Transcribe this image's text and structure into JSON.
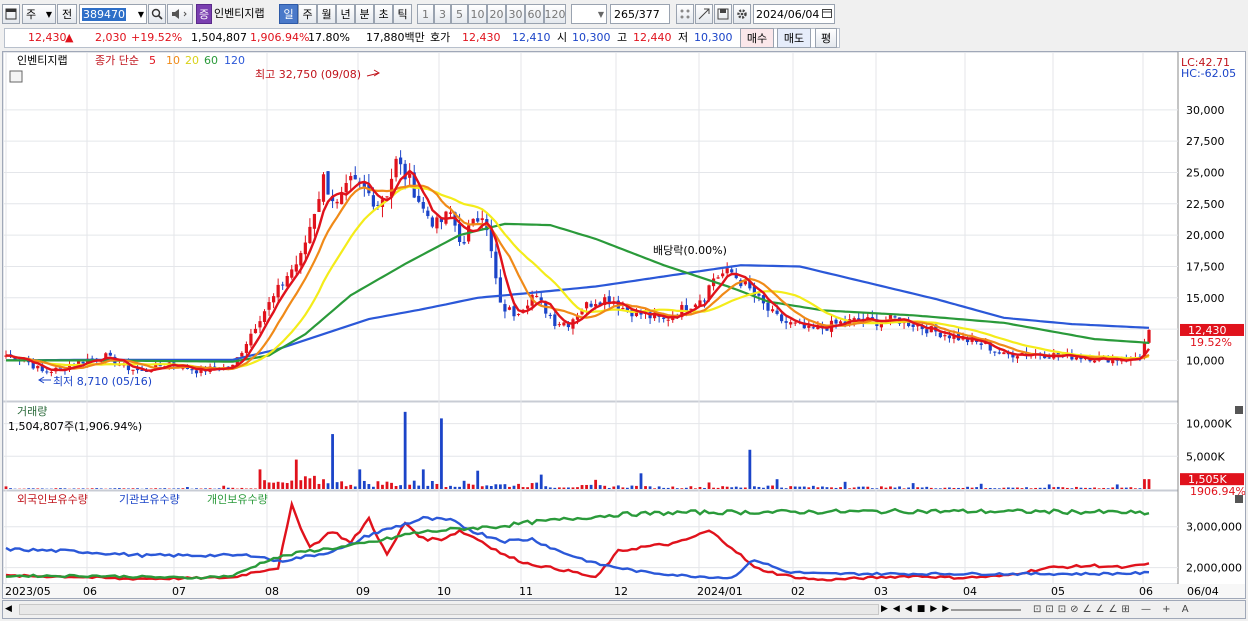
{
  "toolbar": {
    "market_label": "주",
    "prev_label": "전",
    "code": "389470",
    "company_name": "인벤티지랩",
    "company_badge": "증",
    "periods": [
      "일",
      "주",
      "월",
      "년",
      "분",
      "초",
      "틱"
    ],
    "active_period": "일",
    "minute_options": [
      "1",
      "3",
      "5",
      "10",
      "20",
      "30",
      "60",
      "120"
    ],
    "count_current": "265",
    "count_total": "/377",
    "date": "2024/06/04"
  },
  "quote": {
    "price": "12,430",
    "arrow": "▲",
    "change": "2,030",
    "change_rate": "+19.52%",
    "volume": "1,504,807",
    "volume_rate": "1,906.94%",
    "turnover": "17.80%",
    "amount": "17,880백만",
    "bid_label": "호가",
    "bid1": "12,430",
    "bid2": "12,410",
    "open_label": "시",
    "open": "10,300",
    "high_label": "고",
    "high": "12,440",
    "low_label": "저",
    "low": "10,300",
    "buy_label": "매수",
    "sell_label": "매도",
    "eval_label": "평"
  },
  "price_panel": {
    "name": "인벤티지랩",
    "ma_label": "종가 단순",
    "ma_periods": [
      "5",
      "10",
      "20",
      "60",
      "120"
    ],
    "high_annotation": "최고 32,750 (09/08)",
    "low_annotation": "최저 8,710 (05/16)",
    "dividend_annotation": "배당락(0.00%)",
    "lc": "LC:42.71",
    "hc": "HC:-62.05",
    "last_price_tag": "12,430",
    "last_rate_tag": "19.52%",
    "y_ticks": [
      "30,000",
      "27,500",
      "25,000",
      "22,500",
      "20,000",
      "17,500",
      "15,000",
      "12,500",
      "10,000"
    ]
  },
  "volume_panel": {
    "title": "거래량",
    "summary": "1,504,807주(1,906.94%)",
    "y_ticks": [
      "10,000K",
      "5,000K"
    ],
    "last_tag": "1,505K",
    "last_rate": "1906.94%"
  },
  "holding_panel": {
    "series_labels": [
      "외국인보유수량",
      "기관보유수량",
      "개인보유수량"
    ],
    "y_ticks": [
      "3,000,000",
      "2,000,000"
    ]
  },
  "x_axis": [
    "2023/05",
    "06",
    "07",
    "08",
    "09",
    "10",
    "11",
    "12",
    "2024/01",
    "02",
    "03",
    "04",
    "05",
    "06",
    "06/04"
  ],
  "colors": {
    "ma5": "#e0121c",
    "ma10": "#f08a18",
    "ma20": "#f4ec1a",
    "ma60": "#2a9a3a",
    "ma120": "#2b58d8",
    "up": "#e0121c",
    "down": "#1b44c8"
  },
  "chart_data": {
    "type": "candlestick",
    "price_ylim": [
      7000,
      33500
    ],
    "volume_ylim": [
      0,
      13000
    ],
    "holding_ylim": [
      1650000,
      3800000
    ],
    "x_labels": [
      "2023/05",
      "06",
      "07",
      "08",
      "09",
      "10",
      "11",
      "12",
      "2024/01",
      "02",
      "03",
      "04",
      "05",
      "06"
    ],
    "close_path": [
      [
        0,
        10400
      ],
      [
        4,
        10100
      ],
      [
        8,
        9100
      ],
      [
        12,
        9300
      ],
      [
        18,
        10100
      ],
      [
        22,
        10300
      ],
      [
        26,
        9500
      ],
      [
        30,
        9100
      ],
      [
        36,
        9800
      ],
      [
        42,
        9200
      ],
      [
        48,
        9400
      ],
      [
        50,
        9500
      ],
      [
        53,
        11500
      ],
      [
        56,
        13500
      ],
      [
        59,
        15000
      ],
      [
        62,
        16800
      ],
      [
        65,
        18200
      ],
      [
        68,
        22000
      ],
      [
        70,
        24500
      ],
      [
        73,
        22300
      ],
      [
        76,
        24100
      ],
      [
        79,
        23600
      ],
      [
        82,
        22600
      ],
      [
        84,
        23500
      ],
      [
        86,
        25800
      ],
      [
        88,
        24800
      ],
      [
        90,
        23700
      ],
      [
        92,
        22000
      ],
      [
        95,
        20800
      ],
      [
        98,
        21700
      ],
      [
        101,
        19000
      ],
      [
        103,
        21600
      ],
      [
        105,
        21800
      ],
      [
        107,
        18500
      ],
      [
        109,
        14300
      ],
      [
        112,
        13800
      ],
      [
        114,
        14400
      ],
      [
        116,
        15200
      ],
      [
        118,
        14500
      ],
      [
        121,
        13100
      ],
      [
        124,
        13000
      ],
      [
        127,
        14200
      ],
      [
        130,
        14800
      ],
      [
        133,
        15000
      ],
      [
        136,
        14200
      ],
      [
        139,
        13800
      ],
      [
        142,
        13500
      ],
      [
        145,
        13200
      ],
      [
        148,
        13900
      ],
      [
        151,
        14500
      ],
      [
        154,
        15200
      ],
      [
        156,
        16600
      ],
      [
        158,
        16900
      ],
      [
        160,
        17000
      ],
      [
        162,
        16300
      ],
      [
        164,
        15600
      ],
      [
        166,
        14800
      ],
      [
        168,
        14000
      ],
      [
        170,
        13400
      ],
      [
        172,
        13000
      ],
      [
        174,
        12800
      ],
      [
        177,
        12400
      ],
      [
        180,
        12600
      ],
      [
        184,
        13000
      ],
      [
        188,
        13200
      ],
      [
        192,
        13100
      ],
      [
        196,
        13300
      ],
      [
        200,
        12900
      ],
      [
        204,
        12400
      ],
      [
        208,
        12000
      ],
      [
        212,
        11600
      ],
      [
        216,
        11200
      ],
      [
        220,
        10400
      ],
      [
        224,
        10600
      ],
      [
        228,
        10500
      ],
      [
        232,
        10400
      ],
      [
        236,
        10300
      ],
      [
        240,
        10200
      ],
      [
        244,
        10100
      ],
      [
        248,
        10100
      ],
      [
        250,
        10400
      ],
      [
        252,
        12430
      ]
    ],
    "ma120_path": [
      [
        0,
        10000
      ],
      [
        20,
        10050
      ],
      [
        50,
        10050
      ],
      [
        60,
        10900
      ],
      [
        70,
        12100
      ],
      [
        80,
        13300
      ],
      [
        92,
        14100
      ],
      [
        104,
        15000
      ],
      [
        116,
        15400
      ],
      [
        130,
        15900
      ],
      [
        145,
        16700
      ],
      [
        162,
        17600
      ],
      [
        175,
        17500
      ],
      [
        190,
        16200
      ],
      [
        205,
        14900
      ],
      [
        220,
        13400
      ],
      [
        235,
        12900
      ],
      [
        252,
        12600
      ]
    ],
    "ma60_path": [
      [
        0,
        10000
      ],
      [
        20,
        10000
      ],
      [
        50,
        9900
      ],
      [
        58,
        10400
      ],
      [
        66,
        12100
      ],
      [
        76,
        15200
      ],
      [
        88,
        17700
      ],
      [
        100,
        20000
      ],
      [
        110,
        20900
      ],
      [
        120,
        20800
      ],
      [
        130,
        19700
      ],
      [
        145,
        17600
      ],
      [
        160,
        15800
      ],
      [
        168,
        14700
      ],
      [
        180,
        14000
      ],
      [
        200,
        13600
      ],
      [
        220,
        13000
      ],
      [
        240,
        11700
      ],
      [
        252,
        11400
      ]
    ],
    "volume_by_month_peak_k": [
      {
        "x": "2023/05",
        "v": 400
      },
      {
        "x": "07/late",
        "v": 3000
      },
      {
        "x": "08",
        "v": 8400
      },
      {
        "x": "09",
        "v": 12000
      },
      {
        "x": "10",
        "v": 3000
      },
      {
        "x": "11",
        "v": 2500
      },
      {
        "x": "12",
        "v": 1300
      },
      {
        "x": "2024/01",
        "v": 6000
      },
      {
        "x": "02",
        "v": 1100
      },
      {
        "x": "03",
        "v": 800
      },
      {
        "x": "04",
        "v": 700
      },
      {
        "x": "05",
        "v": 700
      },
      {
        "x": "06/04",
        "v": 1505
      }
    ],
    "last_close": 12430,
    "last_volume_k": 1505,
    "holding_series": [
      {
        "name": "외국인보유수량",
        "color": "#e0121c",
        "path": [
          [
            0,
            1800000
          ],
          [
            15,
            1780000
          ],
          [
            25,
            1730000
          ],
          [
            40,
            1740000
          ],
          [
            50,
            1760000
          ],
          [
            55,
            1900000
          ],
          [
            60,
            2000000
          ],
          [
            63,
            3500000
          ],
          [
            67,
            2500000
          ],
          [
            72,
            2900000
          ],
          [
            76,
            2600000
          ],
          [
            80,
            3200000
          ],
          [
            84,
            2300000
          ],
          [
            88,
            3100000
          ],
          [
            92,
            2700000
          ],
          [
            96,
            2700000
          ],
          [
            100,
            2900000
          ],
          [
            104,
            2700000
          ],
          [
            110,
            2300000
          ],
          [
            115,
            2100000
          ],
          [
            120,
            2000000
          ],
          [
            125,
            1900000
          ],
          [
            130,
            1750000
          ],
          [
            135,
            2400000
          ],
          [
            140,
            2500000
          ],
          [
            148,
            2600000
          ],
          [
            155,
            2900000
          ],
          [
            160,
            2500000
          ],
          [
            165,
            2000000
          ],
          [
            170,
            1850000
          ],
          [
            175,
            1750000
          ],
          [
            180,
            1700000
          ],
          [
            190,
            1750000
          ],
          [
            200,
            1800000
          ],
          [
            210,
            1750000
          ],
          [
            220,
            1800000
          ],
          [
            230,
            2000000
          ],
          [
            240,
            2050000
          ],
          [
            247,
            2000000
          ],
          [
            252,
            2100000
          ]
        ]
      },
      {
        "name": "기관보유수량",
        "color": "#2b58d8",
        "path": [
          [
            0,
            2450000
          ],
          [
            15,
            2400000
          ],
          [
            30,
            2300000
          ],
          [
            45,
            2300000
          ],
          [
            55,
            2300000
          ],
          [
            60,
            2150000
          ],
          [
            65,
            2250000
          ],
          [
            70,
            2350000
          ],
          [
            75,
            2500000
          ],
          [
            80,
            2800000
          ],
          [
            86,
            3000000
          ],
          [
            92,
            3200000
          ],
          [
            98,
            3150000
          ],
          [
            104,
            2850000
          ],
          [
            110,
            2650000
          ],
          [
            116,
            2700000
          ],
          [
            122,
            2400000
          ],
          [
            130,
            2100000
          ],
          [
            140,
            1900000
          ],
          [
            150,
            1800000
          ],
          [
            160,
            1750000
          ],
          [
            165,
            2200000
          ],
          [
            172,
            1900000
          ],
          [
            180,
            1850000
          ],
          [
            200,
            1850000
          ],
          [
            220,
            1850000
          ],
          [
            240,
            1850000
          ],
          [
            252,
            1870000
          ]
        ]
      },
      {
        "name": "개인보유수량",
        "color": "#2a9a3a",
        "path": [
          [
            0,
            1800000
          ],
          [
            20,
            1800000
          ],
          [
            40,
            1750000
          ],
          [
            50,
            1800000
          ],
          [
            58,
            2200000
          ],
          [
            66,
            2400000
          ],
          [
            74,
            2500000
          ],
          [
            82,
            2650000
          ],
          [
            90,
            2850000
          ],
          [
            100,
            2950000
          ],
          [
            108,
            3000000
          ],
          [
            115,
            3100000
          ],
          [
            125,
            3200000
          ],
          [
            135,
            3300000
          ],
          [
            150,
            3350000
          ],
          [
            170,
            3360000
          ],
          [
            200,
            3380000
          ],
          [
            230,
            3370000
          ],
          [
            248,
            3350000
          ],
          [
            252,
            3300000
          ]
        ]
      }
    ]
  }
}
